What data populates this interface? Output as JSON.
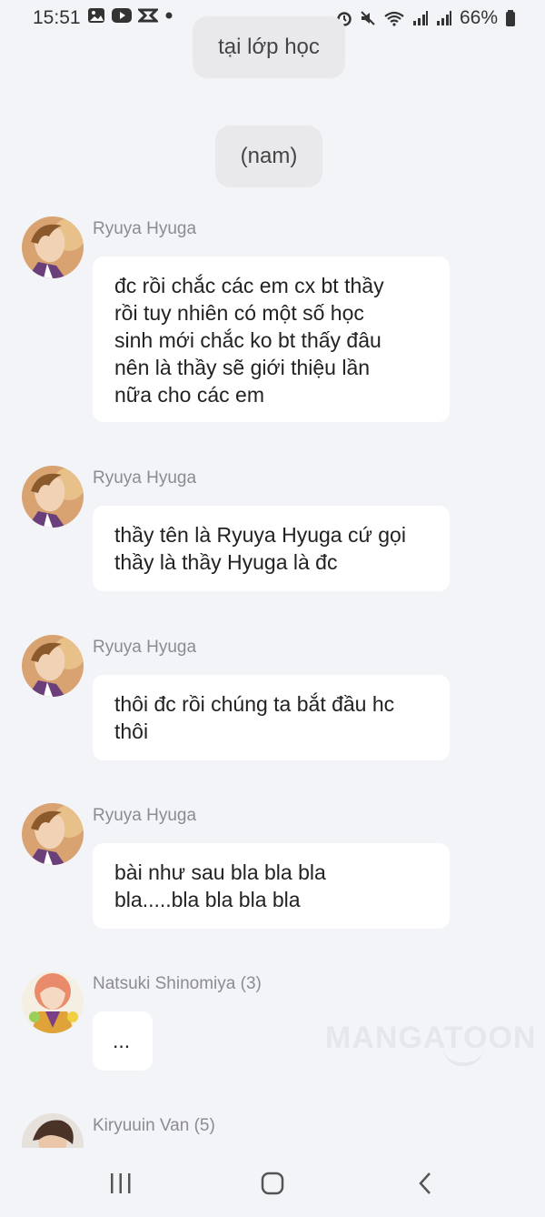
{
  "status_bar": {
    "time": "15:51",
    "battery": "66%"
  },
  "narrations": [
    {
      "text": "tại lớp học"
    },
    {
      "text": "(nam)"
    }
  ],
  "messages": [
    {
      "sender": "Ryuya Hyuga",
      "avatar": "ryuya-avatar",
      "lines": [
        "đc rồi chắc các em cx bt thầy",
        "rồi tuy nhiên có một số học",
        "sinh mới chắc ko bt thấy đâu",
        "nên là thầy sẽ giới thiệu lần",
        "nữa cho các em"
      ]
    },
    {
      "sender": "Ryuya Hyuga",
      "avatar": "ryuya-avatar",
      "lines": [
        "thầy tên là Ryuya Hyuga cứ gọi",
        "thầy là thầy Hyuga là đc"
      ]
    },
    {
      "sender": "Ryuya Hyuga",
      "avatar": "ryuya-avatar",
      "lines": [
        "thôi đc rồi chúng ta bắt đầu hc",
        "thôi"
      ]
    },
    {
      "sender": "Ryuya Hyuga",
      "avatar": "ryuya-avatar",
      "lines": [
        "bài như sau bla bla bla",
        "bla.....bla bla bla bla"
      ]
    },
    {
      "sender": "Natsuki Shinomiya (3)",
      "avatar": "natsuki-avatar",
      "lines": [
        "..."
      ]
    },
    {
      "sender": "Kiryuuin Van (5)",
      "avatar": "kiryuuin-avatar",
      "lines": []
    }
  ],
  "watermark": "MANGATOON",
  "colors": {
    "background": "#f3f4f8",
    "bubble": "#ffffff",
    "narration": "#e9e9ec",
    "sender_text": "#8b8b90"
  }
}
